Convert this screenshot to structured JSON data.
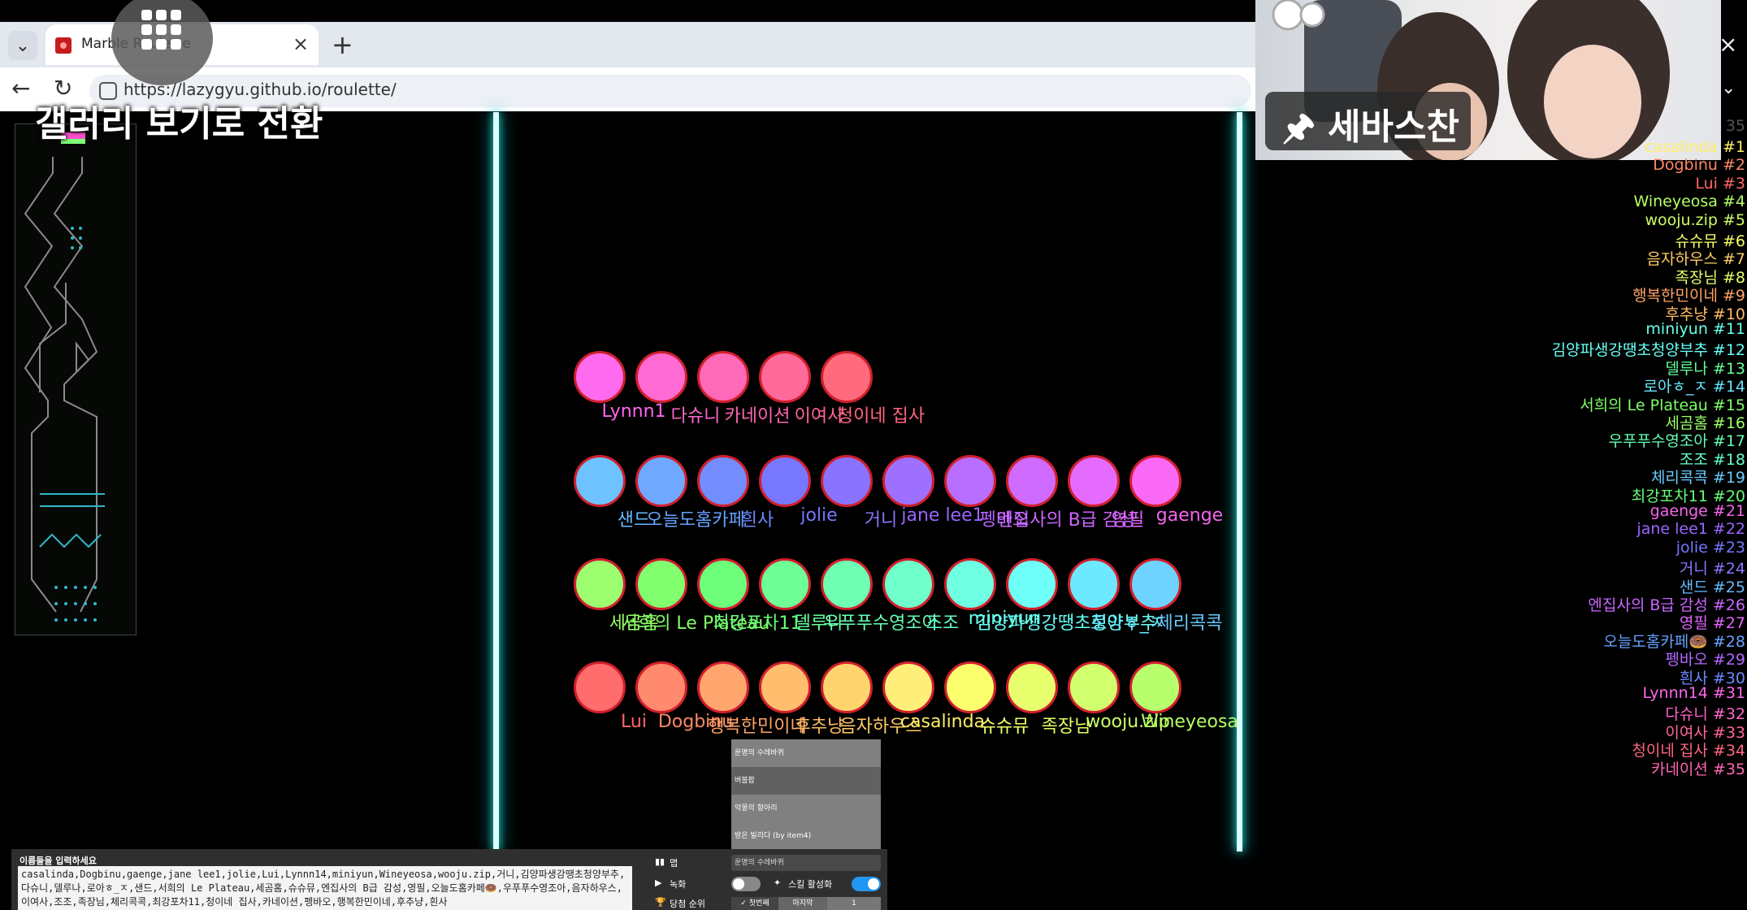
{
  "browser": {
    "tab_title": "Marble Roulette",
    "tab_close": "×",
    "new_tab": "+",
    "url": "https://lazygyu.github.io/roulette/",
    "window_close": "×",
    "tab_menu": "⌄",
    "back": "←",
    "reload": "↻",
    "profile_menu": "⌄"
  },
  "overlay": {
    "gallery_text": "갤러리 보기로 전환"
  },
  "marbles": [
    {
      "color": "#ff6bef",
      "label": "Lynnn1",
      "label_color": "#ff66ee"
    },
    {
      "color": "#ff6ad3",
      "label": "다슈니",
      "label_color": "#ff66cc"
    },
    {
      "color": "#ff6ab8",
      "label": "카네이션",
      "label_color": "#ff66b3"
    },
    {
      "color": "#ff6a9b",
      "label": "이여사",
      "label_color": "#ff6699"
    },
    {
      "color": "#ff6a7c",
      "label": "청이네 집사",
      "label_color": "#ff6680"
    },
    {
      "color": "#6ec2ff",
      "label": "샌드",
      "label_color": "#66bbff"
    },
    {
      "color": "#70a8ff",
      "label": "오늘도홈카페",
      "label_color": "#66a3ff"
    },
    {
      "color": "#738dff",
      "label": "흰사",
      "label_color": "#6e88ff"
    },
    {
      "color": "#7778ff",
      "label": "jolie",
      "label_color": "#7777ff"
    },
    {
      "color": "#8a74ff",
      "label": "거니",
      "label_color": "#8877ff"
    },
    {
      "color": "#9e70ff",
      "label": "jane lee1",
      "label_color": "#9966ff"
    },
    {
      "color": "#b86eff",
      "label": "펭바오",
      "label_color": "#b366ff"
    },
    {
      "color": "#cf6bff",
      "label": "엔집사의 B급 감성",
      "label_color": "#cc66ff"
    },
    {
      "color": "#e56bff",
      "label": "영필",
      "label_color": "#e066ff"
    },
    {
      "color": "#fa69f5",
      "label": "gaenge",
      "label_color": "#f566ee"
    },
    {
      "color": "#9dff70",
      "label": "세곰홈",
      "label_color": "#99ff66"
    },
    {
      "color": "#82ff6e",
      "label": "서희의 Le Plateau",
      "label_color": "#80ff66"
    },
    {
      "color": "#6eff7a",
      "label": "최강포차11",
      "label_color": "#66ff77"
    },
    {
      "color": "#6eff96",
      "label": "델루나",
      "label_color": "#66ff99"
    },
    {
      "color": "#6effb2",
      "label": "우푸푸수영조아",
      "label_color": "#66ffb3"
    },
    {
      "color": "#6effcb",
      "label": "조조",
      "label_color": "#66ffcc"
    },
    {
      "color": "#6effe3",
      "label": "miniyun",
      "label_color": "#66ffe6"
    },
    {
      "color": "#6efff8",
      "label": "김양파생강땡초청양부추",
      "label_color": "#66fff5"
    },
    {
      "color": "#6ee8ff",
      "label": "로아ㅎ_ㅈ",
      "label_color": "#66e6ff"
    },
    {
      "color": "#6ed3ff",
      "label": "체리콕콕",
      "label_color": "#66ccff"
    },
    {
      "color": "#ff6d6d",
      "label": "Lui",
      "label_color": "#ff6666"
    },
    {
      "color": "#ff8a6e",
      "label": "Dogbinu",
      "label_color": "#ff8866"
    },
    {
      "color": "#ffa56e",
      "label": "행복한민이네",
      "label_color": "#ffa366"
    },
    {
      "color": "#ffbd6e",
      "label": "후추냥",
      "label_color": "#ffbb66"
    },
    {
      "color": "#ffd46e",
      "label": "음자하우스",
      "label_color": "#ffcc66"
    },
    {
      "color": "#ffef7a",
      "label": "casalinda",
      "label_color": "#ffee66"
    },
    {
      "color": "#fbff6e",
      "label": "슈슈뮤",
      "label_color": "#f5ff66"
    },
    {
      "color": "#e8ff6e",
      "label": "족장님",
      "label_color": "#e6ff66"
    },
    {
      "color": "#d2ff6e",
      "label": "wooju.zip",
      "label_color": "#ccff66"
    },
    {
      "color": "#b8ff6e",
      "label": "Wineyeosa",
      "label_color": "#b3ff66"
    }
  ],
  "dropdown": {
    "options": [
      "운명의 수레바퀴",
      "버블팝",
      "악몽의 항아리",
      "방은 빌리다 (by item4)"
    ],
    "selected_index": 1
  },
  "panel": {
    "names_label": "이름들을 입력하세요",
    "names_value": "casalinda,Dogbinu,gaenge,jane lee1,jolie,Lui,Lynnn14,miniyun,Wineyeosa,wooju.zip,거니,김양파생강땡초청양부추,다슈니,델루나,로아ㅎ_ㅈ,샌드,서희의 Le Plateau,세곰홈,슈슈뮤,엔집사의 B급 감성,영필,오늘도홈카페🍩,우푸푸수영조아,음자하우스,이여사,조조,족장님,체리콕콕,최강포차11,청이네 집사,카네이션,펭바오,행복한민이네,후추냥,흰사",
    "map_label": "맵",
    "map_value": "운명의 수레바퀴",
    "record_label": "녹화",
    "skill_label": "스킬 활성화",
    "rank_label": "당첨 순위",
    "rank_first": "✓ 첫번째",
    "rank_last": "마지막",
    "rank_number": "1",
    "record_on": false,
    "skill_on": true
  },
  "webcam": {
    "name": "🖈 세바스찬"
  },
  "ranking": {
    "total": "35",
    "items": [
      {
        "name": "casalinda #1",
        "color": "#ffee66"
      },
      {
        "name": "Dogbinu #2",
        "color": "#ff8866"
      },
      {
        "name": "Lui #3",
        "color": "#ff6666"
      },
      {
        "name": "Wineyeosa #4",
        "color": "#b3ff66"
      },
      {
        "name": "wooju.zip #5",
        "color": "#ccff66"
      },
      {
        "name": "슈슈뮤 #6",
        "color": "#f5ff66"
      },
      {
        "name": "음자하우스 #7",
        "color": "#ffcc66"
      },
      {
        "name": "족장님 #8",
        "color": "#e6ff66"
      },
      {
        "name": "행복한민이네 #9",
        "color": "#ffa366"
      },
      {
        "name": "후추냥 #10",
        "color": "#ffbb66"
      },
      {
        "name": "miniyun #11",
        "color": "#66ffe6"
      },
      {
        "name": "김양파생강땡초청양부추 #12",
        "color": "#66fff5"
      },
      {
        "name": "델루나 #13",
        "color": "#66ff99"
      },
      {
        "name": "로아ㅎ_ㅈ #14",
        "color": "#66e6ff"
      },
      {
        "name": "서희의 Le Plateau #15",
        "color": "#80ff66"
      },
      {
        "name": "세곰홈 #16",
        "color": "#99ff66"
      },
      {
        "name": "우푸푸수영조아 #17",
        "color": "#66ffb3"
      },
      {
        "name": "조조 #18",
        "color": "#66ffcc"
      },
      {
        "name": "체리콕콕 #19",
        "color": "#66ccff"
      },
      {
        "name": "최강포차11 #20",
        "color": "#66ff77"
      },
      {
        "name": "gaenge #21",
        "color": "#f566ee"
      },
      {
        "name": "jane lee1 #22",
        "color": "#9966ff"
      },
      {
        "name": "jolie #23",
        "color": "#7777ff"
      },
      {
        "name": "거니 #24",
        "color": "#8877ff"
      },
      {
        "name": "샌드 #25",
        "color": "#66bbff"
      },
      {
        "name": "엔집사의 B급 감성 #26",
        "color": "#cc66ff"
      },
      {
        "name": "영필 #27",
        "color": "#e066ff"
      },
      {
        "name": "오늘도홈카페🍩 #28",
        "color": "#66a3ff"
      },
      {
        "name": "펭바오 #29",
        "color": "#b366ff"
      },
      {
        "name": "흰사 #30",
        "color": "#6e88ff"
      },
      {
        "name": "Lynnn14 #31",
        "color": "#ff66ee"
      },
      {
        "name": "다슈니 #32",
        "color": "#ff66cc"
      },
      {
        "name": "이여사 #33",
        "color": "#ff6699"
      },
      {
        "name": "청이네 집사 #34",
        "color": "#ff6680"
      },
      {
        "name": "카네이션 #35",
        "color": "#ff66b3"
      }
    ]
  }
}
